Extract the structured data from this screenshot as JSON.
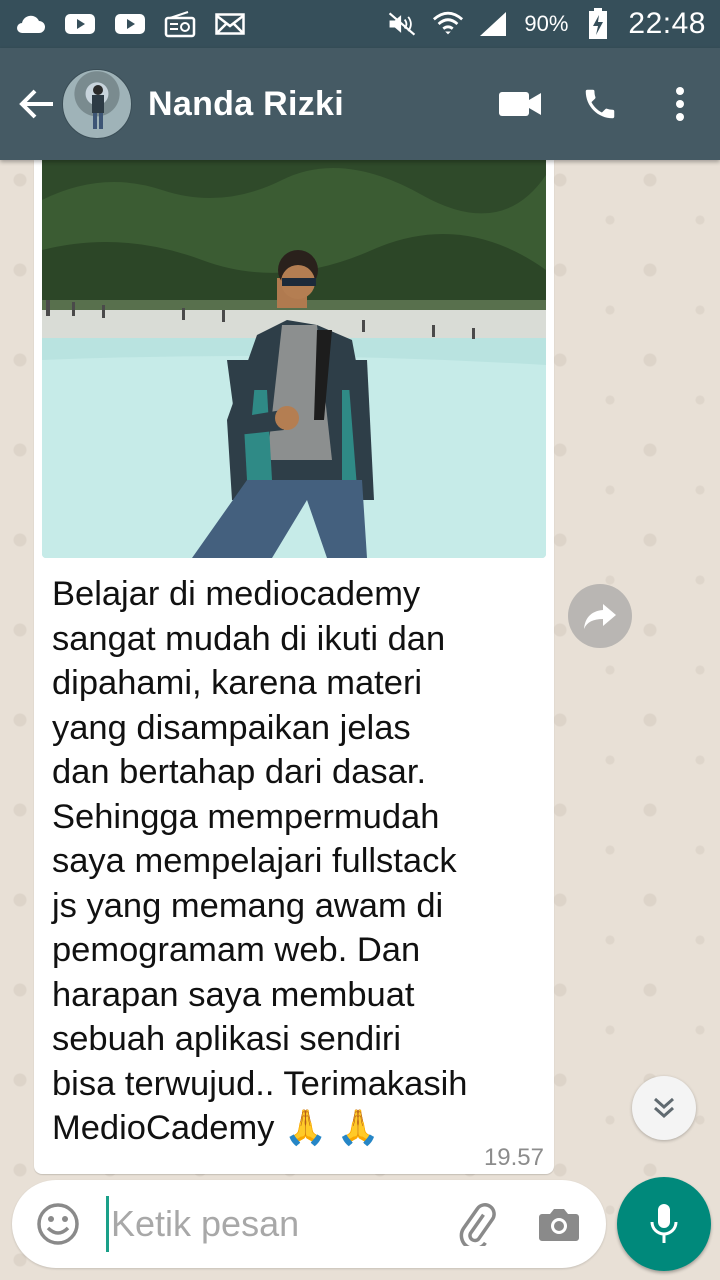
{
  "status_bar": {
    "battery": "90%",
    "time": "22:48"
  },
  "header": {
    "contact_name": "Nanda Rizki",
    "icons": [
      "back-arrow-icon",
      "video-call-icon",
      "phone-icon",
      "more-vert-icon"
    ]
  },
  "message": {
    "text": "Belajar di mediocademy\nsangat mudah di ikuti dan\ndipahami, karena materi\nyang disampaikan jelas\ndan bertahap dari dasar.\nSehingga mempermudah\nsaya mempelajari fullstack\njs yang memang awam di\npemogramam web. Dan\nharapan saya membuat\nsebuah aplikasi sendiri\nbisa terwujud.. Terimakasih\nMedioCademy 🙏 🙏",
    "time": "19.57"
  },
  "composer": {
    "placeholder": "Ketik pesan"
  },
  "colors": {
    "status_bar": "#364f5a",
    "app_bar": "#455a64",
    "accent": "#00897b",
    "chat_bg": "#e8e0d6"
  }
}
